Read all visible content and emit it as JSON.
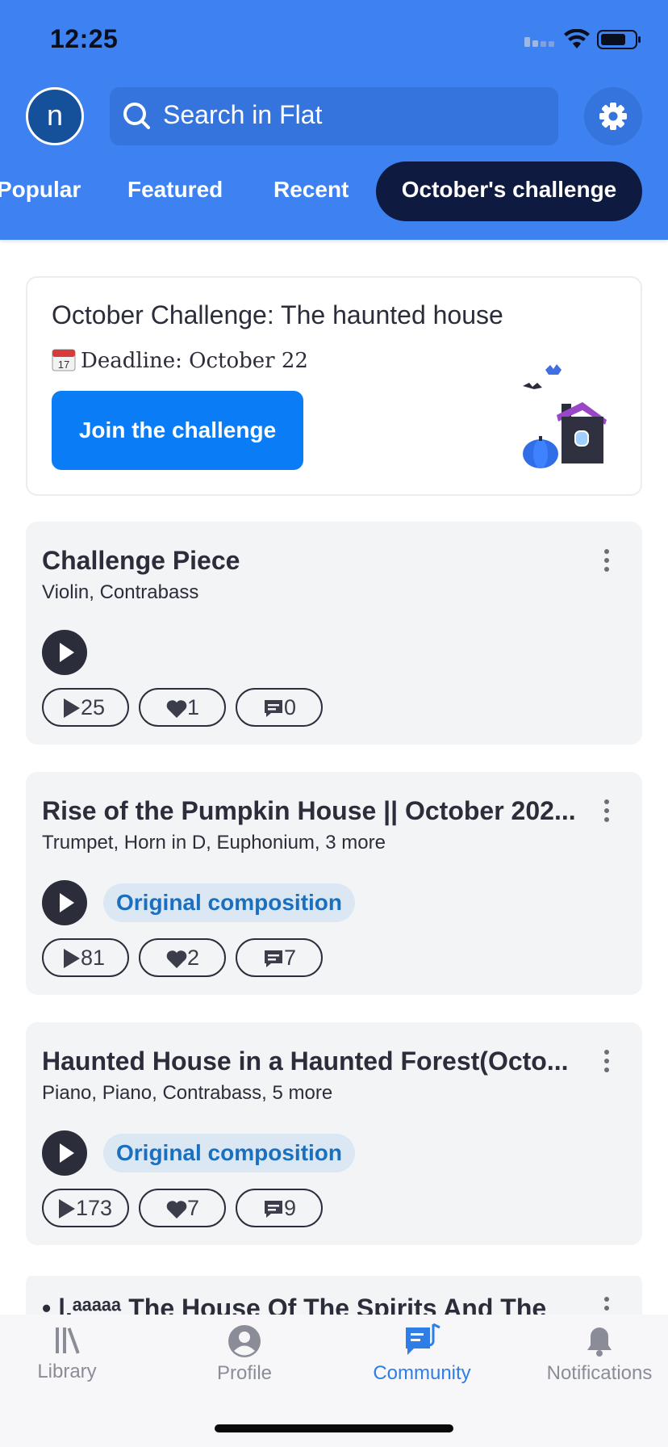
{
  "status_bar": {
    "time": "12:25"
  },
  "header": {
    "avatar_letter": "n",
    "search_placeholder": "Search in Flat",
    "tabs": [
      {
        "label": "Popular"
      },
      {
        "label": "Featured"
      },
      {
        "label": "Recent"
      },
      {
        "label": "October's challenge",
        "active": true
      }
    ]
  },
  "challenge": {
    "title": "October Challenge: The haunted house",
    "deadline": "Deadline: October 22",
    "calendar_day": "17",
    "button_label": "Join the challenge"
  },
  "scores": [
    {
      "title": "Challenge Piece",
      "instruments": "Violin, Contrabass",
      "tag": "",
      "plays": "25",
      "likes": "1",
      "comments": "0"
    },
    {
      "title": "Rise of the Pumpkin House || October 202...",
      "instruments": "Trumpet, Horn in D, Euphonium, 3 more",
      "tag": "Original composition",
      "plays": "81",
      "likes": "2",
      "comments": "7"
    },
    {
      "title": "Haunted House in a Haunted Forest(Octo...",
      "instruments": "Piano, Piano, Contrabass, 5 more",
      "tag": "Original composition",
      "plays": "173",
      "likes": "7",
      "comments": "9"
    },
    {
      "title": "• |.ᵃᵃᵃᵃᵃ The House Of The Spirits And The"
    }
  ],
  "bottom_nav": [
    {
      "label": "Library",
      "icon": "library-icon"
    },
    {
      "label": "Profile",
      "icon": "profile-icon"
    },
    {
      "label": "Community",
      "icon": "community-icon",
      "active": true
    },
    {
      "label": "Notifications",
      "icon": "bell-icon"
    }
  ],
  "colors": {
    "header": "#3d82f0",
    "active_tab": "#0e1a3f",
    "primary_button": "#0a7cf5",
    "active_nav": "#2f7ee6",
    "tag_text": "#1a6fbe"
  }
}
